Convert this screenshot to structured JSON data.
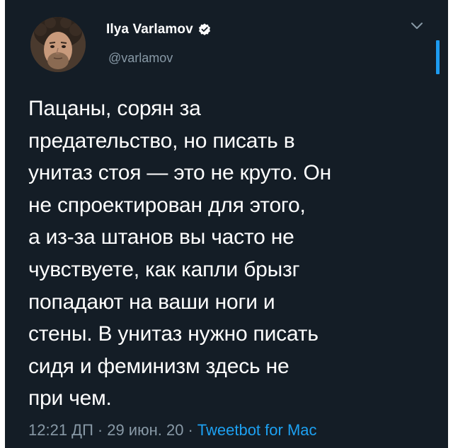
{
  "user": {
    "display_name": "Ilya Varlamov",
    "handle": "@varlamov",
    "verified": true
  },
  "tweet": {
    "text": "Пацаны, сорян за\nпредательство, но писать в\nунитаз стоя — это не круто. Он\nне спроектирован для этого,\nа из-за штанов вы часто не\nчувствуете, как капли брызг\nпопадают на ваши ноги и\nстены. В унитаз нужно писать\nсидя и феминизм здесь не\nпри чем.",
    "time": "12:21 ДП",
    "separator": "·",
    "date": "29 июн. 20",
    "source": "Tweetbot for Mac"
  },
  "icons": {
    "verified": "verified-badge-icon",
    "menu": "chevron-down-icon"
  },
  "colors": {
    "background": "#141d26",
    "text": "#ffffff",
    "secondary_text": "#8899a6",
    "link": "#1da1f2",
    "accent_bar": "#1d9bf0"
  }
}
